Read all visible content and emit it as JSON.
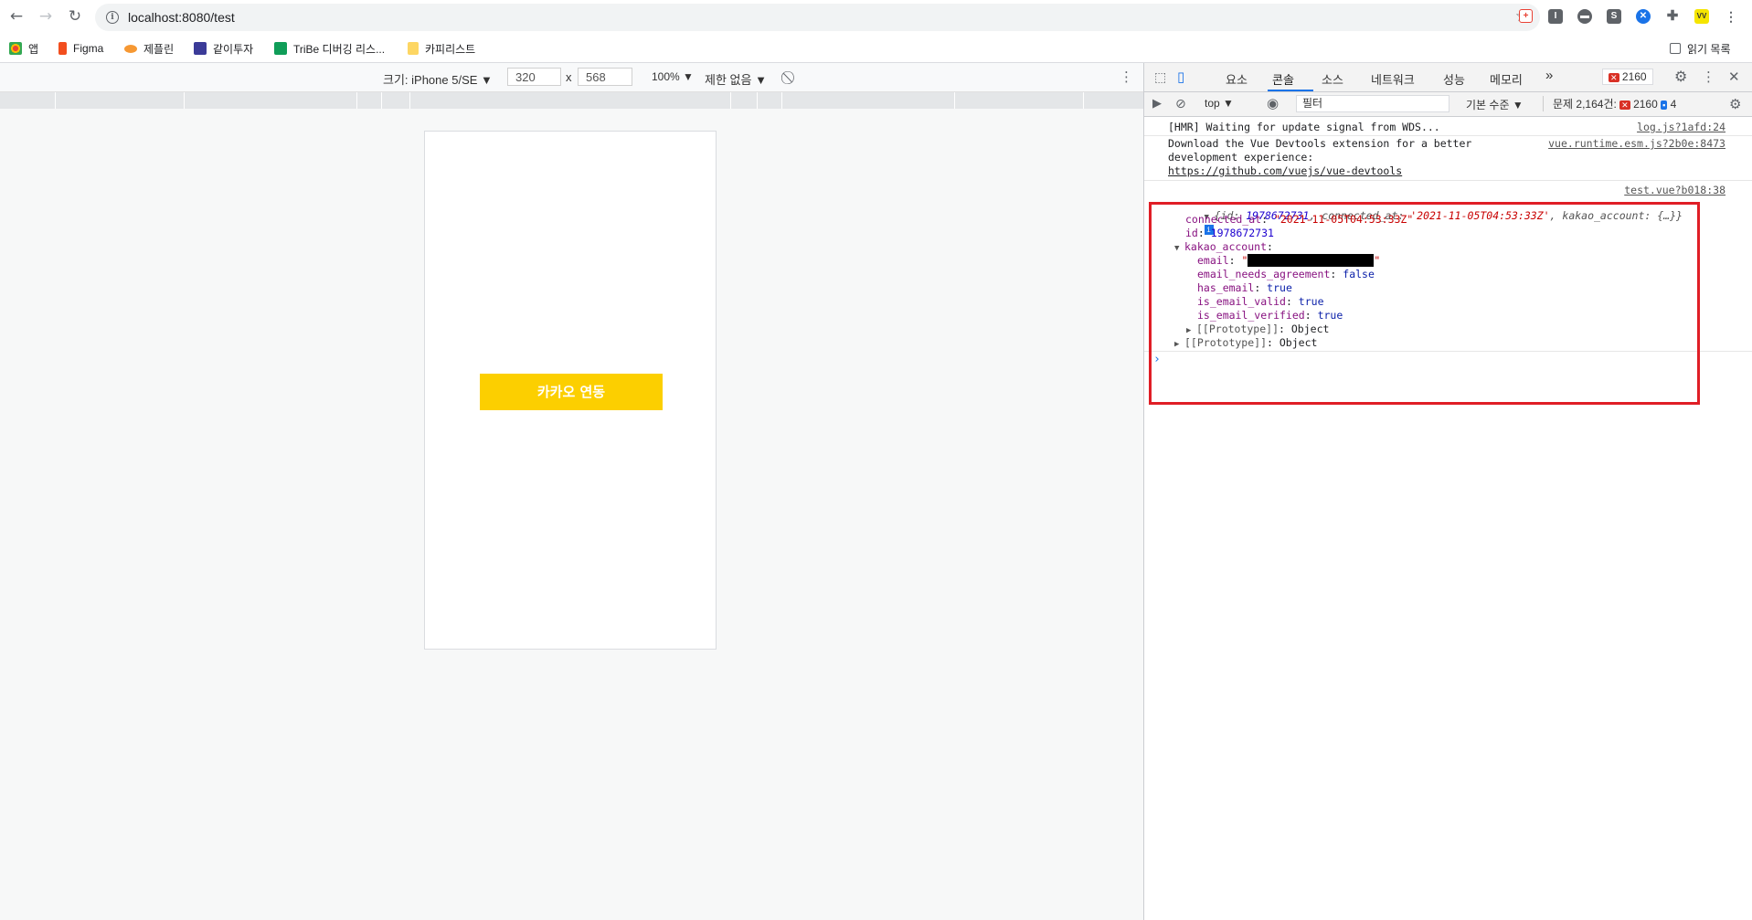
{
  "browser": {
    "url": "localhost:8080/test",
    "bookmarks": [
      {
        "label": "앱",
        "color": "#ea4335"
      },
      {
        "label": "Figma",
        "color": "#f24e1e"
      },
      {
        "label": "제플린",
        "color": "#f69833"
      },
      {
        "label": "같이투자",
        "color": "#3b3b98"
      },
      {
        "label": "TriBe 디버깅 리스...",
        "color": "#0f9d58"
      },
      {
        "label": "카피리스트",
        "color": "#fdd663"
      }
    ],
    "reading_list": "읽기 목록"
  },
  "device_toolbar": {
    "device_label": "크기: iPhone 5/SE ▼",
    "width": "320",
    "times": "x",
    "height": "568",
    "zoom": "100% ▼",
    "throttle": "제한 없음 ▼"
  },
  "page": {
    "kakao_button_label": "카카오 연동",
    "kakao_color": "#fccf00"
  },
  "devtools": {
    "tabs": [
      "요소",
      "콘솔",
      "소스",
      "네트워크",
      "성능",
      "메모리"
    ],
    "active_tab": "콘솔",
    "more_tabs": "»",
    "error_count": "2160",
    "context": "top ▼",
    "filter_placeholder": "필터",
    "level": "기본 수준 ▼",
    "issues_label": "문제 2,164건:",
    "issues_errors": "2160",
    "issues_info": "4"
  },
  "console": {
    "hmr_message": "[HMR] Waiting for update signal from WDS...",
    "hmr_source": "log.js?1afd:24",
    "vue_message_1": "Download the Vue Devtools extension for a better",
    "vue_message_2": "development experience:",
    "vue_link": "https://github.com/vuejs/vue-devtools",
    "vue_source": "vue.runtime.esm.js?2b0e:8473",
    "log_source": "test.vue?b018:38",
    "object_preview": "{id: 1978672731, connected_at: '2021-11-05T04:53:33Z', kakao_account: {…}}",
    "preview_open": "{",
    "preview_id_key": "id: ",
    "preview_id_val": "1978672731",
    "preview_conn_key": ", connected_at: ",
    "preview_conn_val": "'2021-11-05T04:53:33Z'",
    "preview_kakao_key": ", kakao_account: ",
    "preview_kakao_val": "{…}}",
    "connected_at_key": "connected_at",
    "connected_at_val": "\"2021-11-05T04:53:33Z\"",
    "id_key": "id",
    "id_val": "1978672731",
    "kakao_account_key": "kakao_account",
    "email_key": "email",
    "email_open_quote": "\"",
    "email_close_quote": "\"",
    "email_needs_agreement_key": "email_needs_agreement",
    "email_needs_agreement_val": "false",
    "has_email_key": "has_email",
    "has_email_val": "true",
    "is_email_valid_key": "is_email_valid",
    "is_email_valid_val": "true",
    "is_email_verified_key": "is_email_verified",
    "is_email_verified_val": "true",
    "proto_key": "[[Prototype]]",
    "proto_val": "Object",
    "colon": ": ",
    "prompt": "›"
  }
}
